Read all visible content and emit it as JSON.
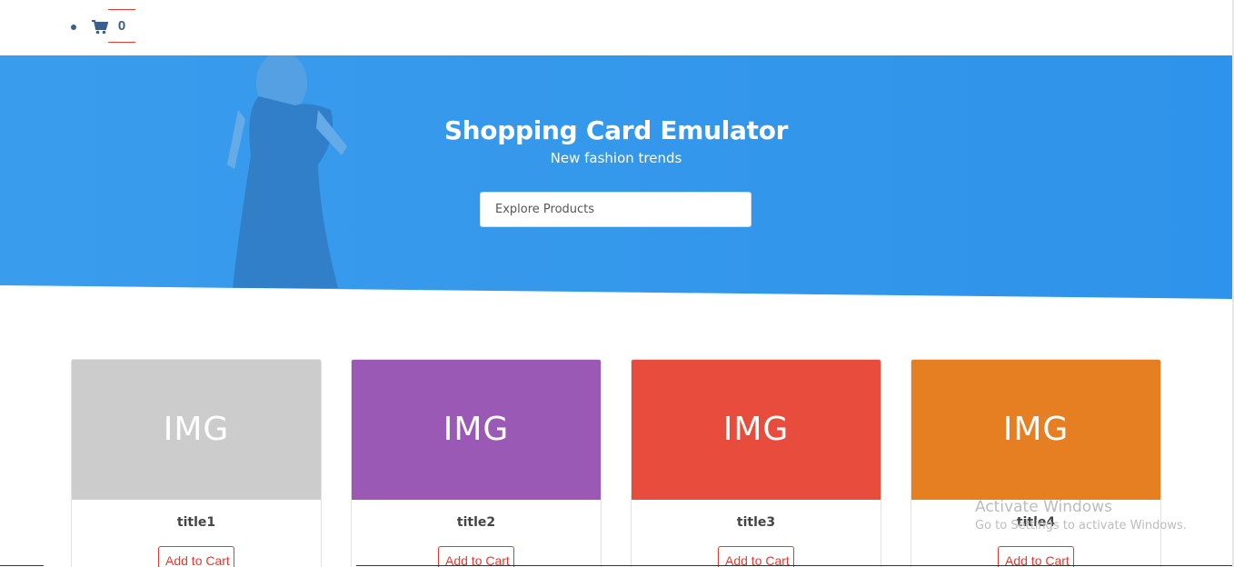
{
  "nav": {
    "cart_icon": "shopping-cart-icon",
    "cart_count": "0"
  },
  "hero": {
    "title": "Shopping Card Emulator",
    "subtitle": "New fashion trends",
    "search_placeholder": "Explore Products",
    "background_color": "#3197ec"
  },
  "products": [
    {
      "image_label": "IMG",
      "title": "title1",
      "button_label": "Add to Cart",
      "image_color": "#cccccc"
    },
    {
      "image_label": "IMG",
      "title": "title2",
      "button_label": "Add to Cart",
      "image_color": "#9b59b6"
    },
    {
      "image_label": "IMG",
      "title": "title3",
      "button_label": "Add to Cart",
      "image_color": "#e74c3c"
    },
    {
      "image_label": "IMG",
      "title": "title4",
      "button_label": "Add to Cart",
      "image_color": "#e67e22"
    }
  ],
  "watermark": {
    "title": "Activate Windows",
    "subtitle": "Go to Settings to activate Windows."
  },
  "colors": {
    "accent": "#e53935",
    "nav_text": "#3a5f8f"
  }
}
